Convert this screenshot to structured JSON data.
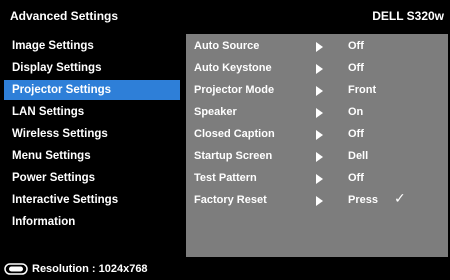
{
  "header": {
    "title": "Advanced Settings",
    "model": "DELL S320w"
  },
  "sidebar": {
    "items": [
      {
        "label": "Image Settings"
      },
      {
        "label": "Display Settings"
      },
      {
        "label": "Projector Settings",
        "active": true
      },
      {
        "label": "LAN Settings"
      },
      {
        "label": "Wireless Settings"
      },
      {
        "label": "Menu Settings"
      },
      {
        "label": "Power Settings"
      },
      {
        "label": "Interactive Settings"
      },
      {
        "label": "Information"
      }
    ]
  },
  "panel": {
    "rows": [
      {
        "label": "Auto Source",
        "value": "Off"
      },
      {
        "label": "Auto Keystone",
        "value": "Off"
      },
      {
        "label": "Projector Mode",
        "value": "Front"
      },
      {
        "label": "Speaker",
        "value": "On"
      },
      {
        "label": "Closed Caption",
        "value": "Off"
      },
      {
        "label": "Startup Screen",
        "value": "Dell"
      },
      {
        "label": "Test Pattern",
        "value": "Off"
      },
      {
        "label": "Factory Reset",
        "value": "Press",
        "check": "✓"
      }
    ]
  },
  "status": {
    "text": "Resolution : 1024x768",
    "icon": "input-source-icon"
  },
  "colors": {
    "active": "#2e7fd8",
    "panel": "#7d7d7d",
    "background": "#000000"
  }
}
